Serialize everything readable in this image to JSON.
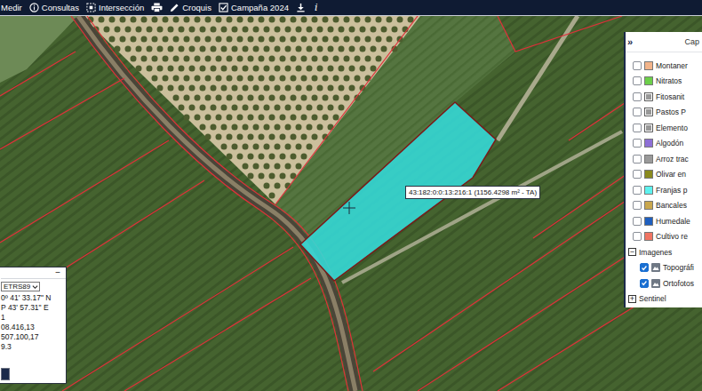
{
  "toolbar": {
    "items": [
      {
        "label": "Medir",
        "kind": "plain"
      },
      {
        "label": "Consultas",
        "kind": "info"
      },
      {
        "label": "Intersección",
        "kind": "select"
      },
      {
        "kind": "print"
      },
      {
        "label": "Croquis",
        "kind": "draw"
      },
      {
        "label": "Campaña 2024",
        "kind": "toggle",
        "checked": true
      },
      {
        "kind": "download"
      },
      {
        "label": "i",
        "kind": "glyph"
      }
    ]
  },
  "map": {
    "selected_parcel": {
      "tooltip": "43:182:0:0:13:216:1 (1156.4298 m² - TA)",
      "selected": true
    }
  },
  "layers_panel": {
    "collapse": "»",
    "title": "Cap",
    "layers": [
      {
        "label": "Montaner",
        "checked": false,
        "kind": "swatch",
        "color": "#f2b48a"
      },
      {
        "label": "Nitratos",
        "checked": false,
        "kind": "swatch",
        "color": "#6ccf4a"
      },
      {
        "label": "Fitosanit",
        "checked": false,
        "kind": "legend"
      },
      {
        "label": "Pastos P",
        "checked": false,
        "kind": "legend"
      },
      {
        "label": "Elemento",
        "checked": false,
        "kind": "legend"
      },
      {
        "label": "Algodón",
        "checked": false,
        "kind": "swatch",
        "color": "#8e6fd6"
      },
      {
        "label": "Arroz trac",
        "checked": false,
        "kind": "swatch",
        "color": "#9a9a9a"
      },
      {
        "label": "Olivar en",
        "checked": false,
        "kind": "swatch",
        "color": "#8a8a1e"
      },
      {
        "label": "Franjas p",
        "checked": false,
        "kind": "swatch",
        "color": "#5ef2ef"
      },
      {
        "label": "Bancales",
        "checked": false,
        "kind": "swatch",
        "color": "#c9a74e"
      },
      {
        "label": "Humedale",
        "checked": false,
        "kind": "swatch",
        "color": "#1f5fbf"
      },
      {
        "label": "Cultivo re",
        "checked": false,
        "kind": "swatch",
        "color": "#f07462"
      }
    ],
    "groups": [
      {
        "label": "Imagenes",
        "toggle": "−",
        "expanded": true,
        "items": [
          {
            "label": "Topográfi",
            "checked": true,
            "kind": "image"
          },
          {
            "label": "Ortofotos",
            "checked": true,
            "kind": "image"
          }
        ]
      },
      {
        "label": "Sentinel",
        "toggle": "+",
        "expanded": false,
        "items": []
      }
    ]
  },
  "coords_panel": {
    "minimize": "−",
    "projection": "ETRS89",
    "lines": [
      "0º 41' 33.17\" N",
      "P 43' 57.31\" E",
      "1",
      "08.416,13",
      "507.100,17",
      "9.3"
    ]
  }
}
